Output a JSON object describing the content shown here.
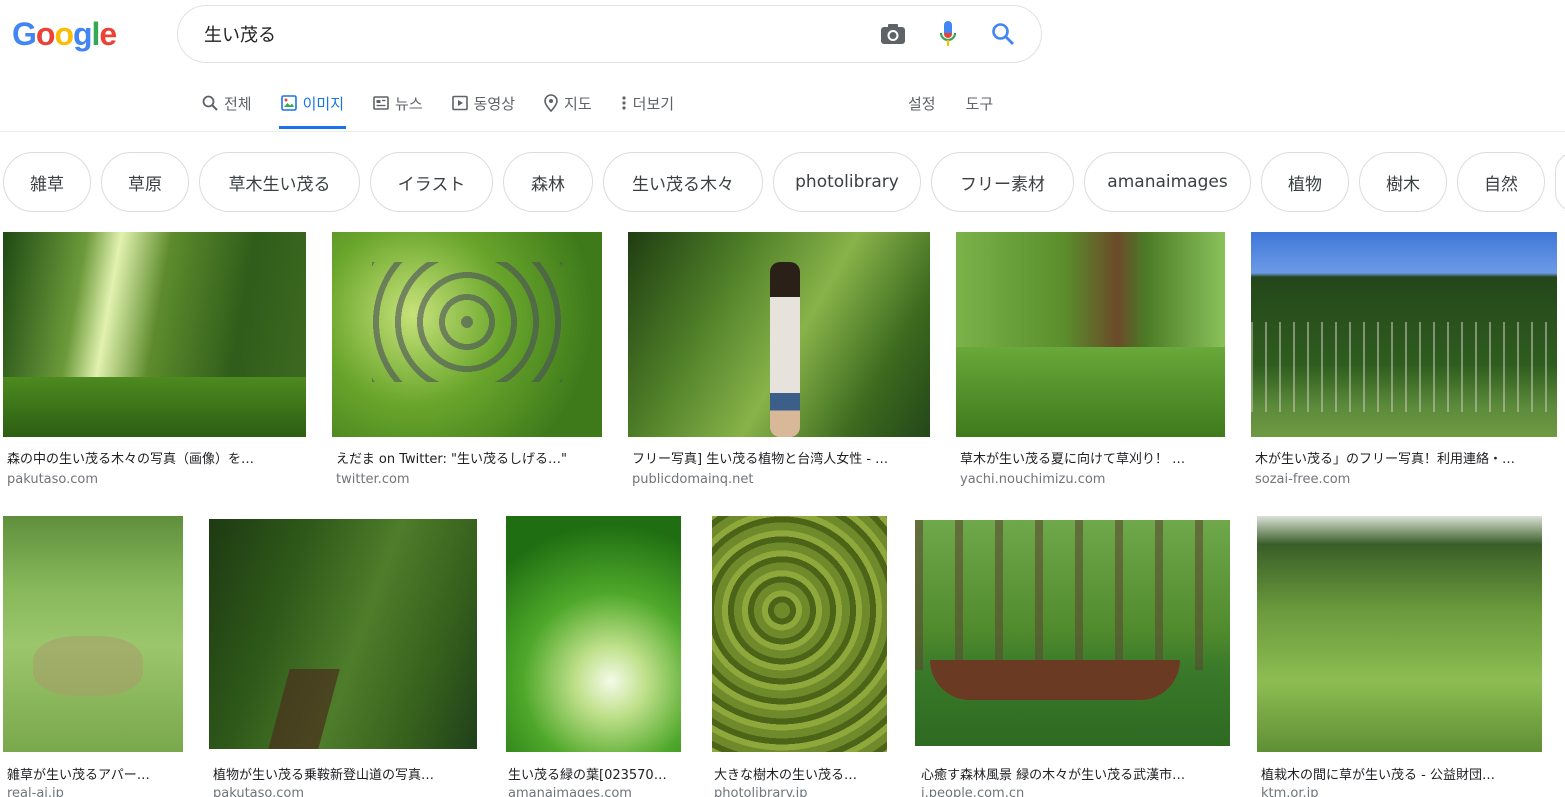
{
  "search": {
    "query": "生い茂る"
  },
  "logo": {
    "letters": [
      "G",
      "o",
      "o",
      "g",
      "l",
      "e"
    ]
  },
  "tabs": [
    {
      "label": "전체",
      "icon": "search-icon"
    },
    {
      "label": "이미지",
      "icon": "image-icon",
      "active": true
    },
    {
      "label": "뉴스",
      "icon": "news-icon"
    },
    {
      "label": "동영상",
      "icon": "video-icon"
    },
    {
      "label": "지도",
      "icon": "map-pin-icon"
    },
    {
      "label": "더보기",
      "icon": "more-vert-icon"
    }
  ],
  "tools": {
    "settings": "설정",
    "tools": "도구"
  },
  "chips": [
    "雑草",
    "草原",
    "草木生い茂る",
    "イラスト",
    "森林",
    "生い茂る木々",
    "photolibrary",
    "フリー素材",
    "amanaimages",
    "植物",
    "樹木",
    "自然"
  ],
  "results": [
    {
      "caption": "森の中の生い茂る木々の写真（画像）を…",
      "source": "pakutaso.com"
    },
    {
      "caption": "えだま on Twitter: \"生い茂るしげる…\"",
      "source": "twitter.com"
    },
    {
      "caption": "フリー写真] 生い茂る植物と台湾人女性 - …",
      "source": "publicdomainq.net"
    },
    {
      "caption": "草木が生い茂る夏に向けて草刈り！ …",
      "source": "yachi.nouchimizu.com"
    },
    {
      "caption": "木が生い茂る」のフリー写真！利用連絡・…",
      "source": "sozai-free.com"
    },
    {
      "caption": "雑草が生い茂るアパー…",
      "source": "real-ai.jp"
    },
    {
      "caption": "植物が生い茂る乗鞍新登山道の写真…",
      "source": "pakutaso.com"
    },
    {
      "caption": "生い茂る緑の葉[023570…",
      "source": "amanaimages.com"
    },
    {
      "caption": "大きな樹木の生い茂る…",
      "source": "photolibrary.jp"
    },
    {
      "caption": "心癒す森林風景 緑の木々が生い茂る武漢市…",
      "source": "j.people.com.cn"
    },
    {
      "caption": "植栽木の間に草が生い茂る - 公益財団…",
      "source": "ktm.or.jp"
    }
  ],
  "colors": {
    "accent": "#1a73e8",
    "logo": [
      "#4285f4",
      "#ea4335",
      "#fbbc05",
      "#4285f4",
      "#34a853",
      "#ea4335"
    ]
  }
}
